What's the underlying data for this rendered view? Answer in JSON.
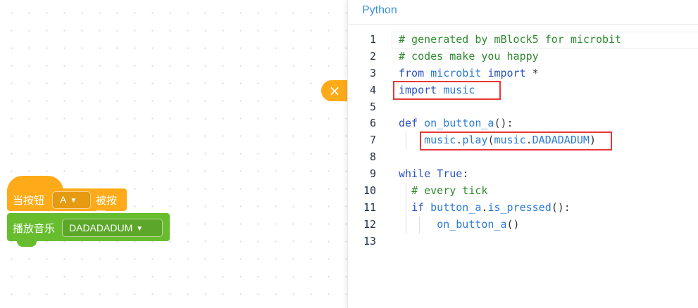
{
  "colors": {
    "event_block": "#ffab19",
    "music_block": "#68bd2f",
    "keyword": "#2a52be",
    "comment": "#2e8b2e",
    "highlight_box": "#e53935",
    "panel_title": "#3a8fd6"
  },
  "panel": {
    "title": "Python",
    "close_icon": "×"
  },
  "code_lines": [
    {
      "num": "1",
      "segments": [
        {
          "t": "# generated by mBlock5 for microbit",
          "k": "c"
        }
      ]
    },
    {
      "num": "2",
      "segments": [
        {
          "t": "# codes make you happy",
          "k": "c"
        }
      ]
    },
    {
      "num": "3",
      "segments": [
        {
          "t": "from",
          "k": "k"
        },
        {
          "t": " microbit ",
          "k": "i"
        },
        {
          "t": "import",
          "k": "k"
        },
        {
          "t": " *",
          "k": "p"
        }
      ]
    },
    {
      "num": "4",
      "segments": [
        {
          "t": "import",
          "k": "k"
        },
        {
          "t": " music",
          "k": "i"
        }
      ]
    },
    {
      "num": "5",
      "segments": []
    },
    {
      "num": "6",
      "segments": [
        {
          "t": "def",
          "k": "k"
        },
        {
          "t": " on_button_a",
          "k": "i"
        },
        {
          "t": "():",
          "k": "p"
        }
      ]
    },
    {
      "num": "7",
      "segments": [
        {
          "t": "    ",
          "k": "p"
        },
        {
          "t": "music",
          "k": "i"
        },
        {
          "t": ".",
          "k": "p"
        },
        {
          "t": "play",
          "k": "i"
        },
        {
          "t": "(",
          "k": "p"
        },
        {
          "t": "music",
          "k": "i"
        },
        {
          "t": ".",
          "k": "p"
        },
        {
          "t": "DADADADUM",
          "k": "i"
        },
        {
          "t": ")",
          "k": "p"
        }
      ]
    },
    {
      "num": "8",
      "segments": []
    },
    {
      "num": "9",
      "segments": [
        {
          "t": "while",
          "k": "k"
        },
        {
          "t": " True",
          "k": "k"
        },
        {
          "t": ":",
          "k": "p"
        }
      ]
    },
    {
      "num": "10",
      "segments": [
        {
          "t": "  ",
          "k": "p"
        },
        {
          "t": "# every tick",
          "k": "c"
        }
      ]
    },
    {
      "num": "11",
      "segments": [
        {
          "t": "  ",
          "k": "p"
        },
        {
          "t": "if",
          "k": "k"
        },
        {
          "t": " button_a",
          "k": "i"
        },
        {
          "t": ".",
          "k": "p"
        },
        {
          "t": "is_pressed",
          "k": "i"
        },
        {
          "t": "():",
          "k": "p"
        }
      ]
    },
    {
      "num": "12",
      "segments": [
        {
          "t": "      ",
          "k": "p"
        },
        {
          "t": "on_button_a",
          "k": "i"
        },
        {
          "t": "()",
          "k": "p"
        }
      ]
    },
    {
      "num": "13",
      "segments": []
    }
  ],
  "blocks": {
    "hat": {
      "prefix": "当按钮",
      "button_value": "A",
      "suffix": "被按下"
    },
    "play": {
      "label": "播放音乐",
      "melody_value": "DADADADUM"
    }
  },
  "icons": {
    "dropdown": "dropdown-triangle-icon"
  }
}
